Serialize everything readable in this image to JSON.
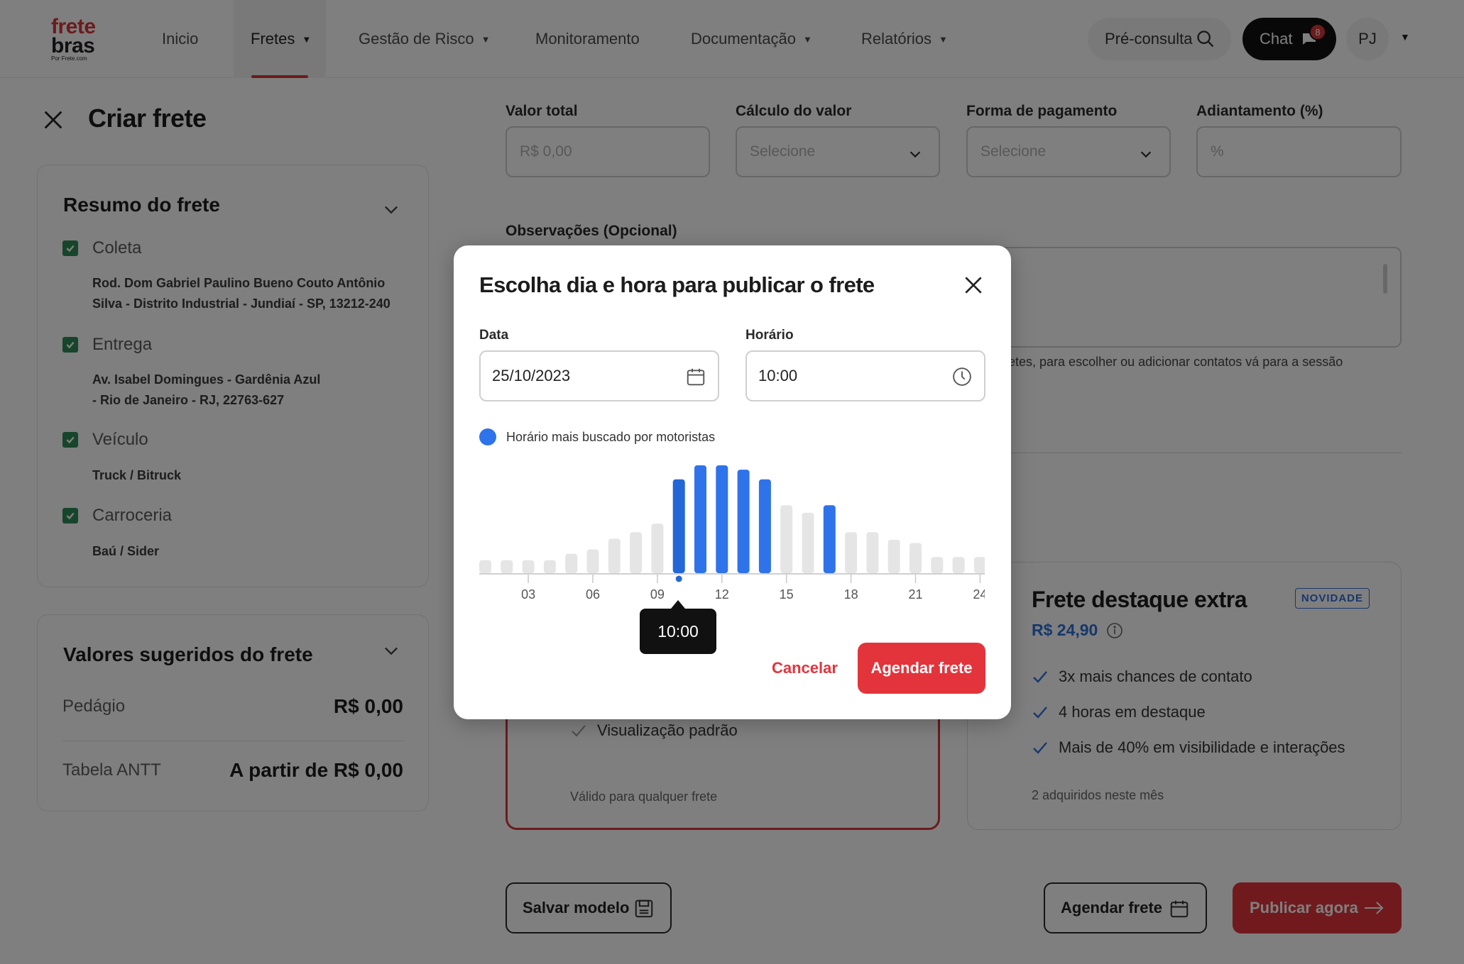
{
  "header": {
    "logo": {
      "line1": "frete",
      "line2": "bras",
      "line3": "Por Frete.com"
    },
    "nav": [
      {
        "label": "Inicio",
        "has_caret": false
      },
      {
        "label": "Fretes",
        "has_caret": true,
        "active": true
      },
      {
        "label": "Gestão de Risco",
        "has_caret": true
      },
      {
        "label": "Monitoramento",
        "has_caret": false
      },
      {
        "label": "Documentação",
        "has_caret": true
      },
      {
        "label": "Relatórios",
        "has_caret": true
      }
    ],
    "pre_consulta": "Pré-consulta",
    "chat": {
      "label": "Chat",
      "badge": "8"
    },
    "avatar": "PJ"
  },
  "page": {
    "title": "Criar frete"
  },
  "resumo": {
    "title": "Resumo do frete",
    "items": [
      {
        "label": "Coleta",
        "detail": [
          "Rod. Dom Gabriel Paulino Bueno Couto Antônio",
          "Silva - Distrito Industrial - Jundiaí - SP, 13212-240"
        ]
      },
      {
        "label": "Entrega",
        "detail": [
          "Av. Isabel Domingues - Gardênia Azul",
          "- Rio de Janeiro - RJ, 22763-627"
        ]
      },
      {
        "label": "Veículo",
        "detail": [
          "Truck / Bitruck"
        ]
      },
      {
        "label": "Carroceria",
        "detail": [
          "Baú / Sider"
        ]
      }
    ]
  },
  "valores": {
    "title": "Valores sugeridos do frete",
    "rows": [
      {
        "label": "Pedágio",
        "value": "R$ 0,00"
      },
      {
        "label": "Tabela ANTT",
        "value": "A partir de R$ 0,00"
      }
    ]
  },
  "form": {
    "valor_total": {
      "label": "Valor total",
      "placeholder": "R$ 0,00"
    },
    "calculo": {
      "label": "Cálculo do valor",
      "placeholder": "Selecione"
    },
    "pagamento": {
      "label": "Forma de pagamento",
      "placeholder": "Selecione"
    },
    "adiantamento": {
      "label": "Adiantamento (%)",
      "placeholder": "%"
    },
    "observacoes": {
      "label": "Observações (Opcional)"
    },
    "hint": "etes, para escolher ou adicionar contatos vá para a sessão"
  },
  "plans": {
    "standard": {
      "feature": "Visualização padrão",
      "footer": "Válido para qualquer frete"
    },
    "extra": {
      "title": "Frete destaque extra",
      "price": "R$ 24,90",
      "badge": "NOVIDADE",
      "features": [
        "3x mais chances de contato",
        "4 horas em destaque",
        "Mais de 40% em visibilidade e interações"
      ],
      "footer": "2 adquiridos neste mês"
    }
  },
  "actions": {
    "salvar_modelo": "Salvar modelo",
    "agendar_frete": "Agendar frete",
    "publicar_agora": "Publicar agora"
  },
  "modal": {
    "title": "Escolha dia e hora para publicar o frete",
    "date_label": "Data",
    "date_value": "25/10/2023",
    "time_label": "Horário",
    "time_value": "10:00",
    "legend": "Horário mais buscado por motoristas",
    "tooltip": "10:00",
    "cancel": "Cancelar",
    "submit": "Agendar frete"
  },
  "chart_data": {
    "type": "bar",
    "title": "",
    "xlabel": "",
    "ylabel": "",
    "x": [
      1,
      2,
      3,
      4,
      5,
      6,
      7,
      8,
      9,
      10,
      11,
      12,
      13,
      14,
      15,
      16,
      17,
      18,
      19,
      20,
      21,
      22,
      23,
      24
    ],
    "values": [
      1.2,
      1.2,
      1.2,
      1.2,
      1.8,
      2.2,
      3.2,
      3.8,
      4.6,
      8.7,
      10,
      10,
      9.6,
      8.7,
      6.3,
      5.6,
      6.3,
      3.8,
      3.8,
      3.1,
      2.8,
      1.5,
      1.5,
      1.5
    ],
    "highlighted": [
      false,
      false,
      false,
      false,
      false,
      false,
      false,
      false,
      false,
      true,
      true,
      true,
      true,
      true,
      false,
      false,
      true,
      false,
      false,
      false,
      false,
      false,
      false,
      false
    ],
    "selected_x": 10,
    "ticks": [
      3,
      6,
      9,
      12,
      15,
      18,
      21,
      24
    ],
    "tick_labels": [
      "03",
      "06",
      "09",
      "12",
      "15",
      "18",
      "21",
      "24"
    ],
    "ylim": [
      0,
      10
    ],
    "colors": {
      "highlight": "#2f73ea",
      "normal": "#e5e5e5",
      "selected": "#2366d8"
    },
    "grid": false,
    "legend": "top-left"
  }
}
